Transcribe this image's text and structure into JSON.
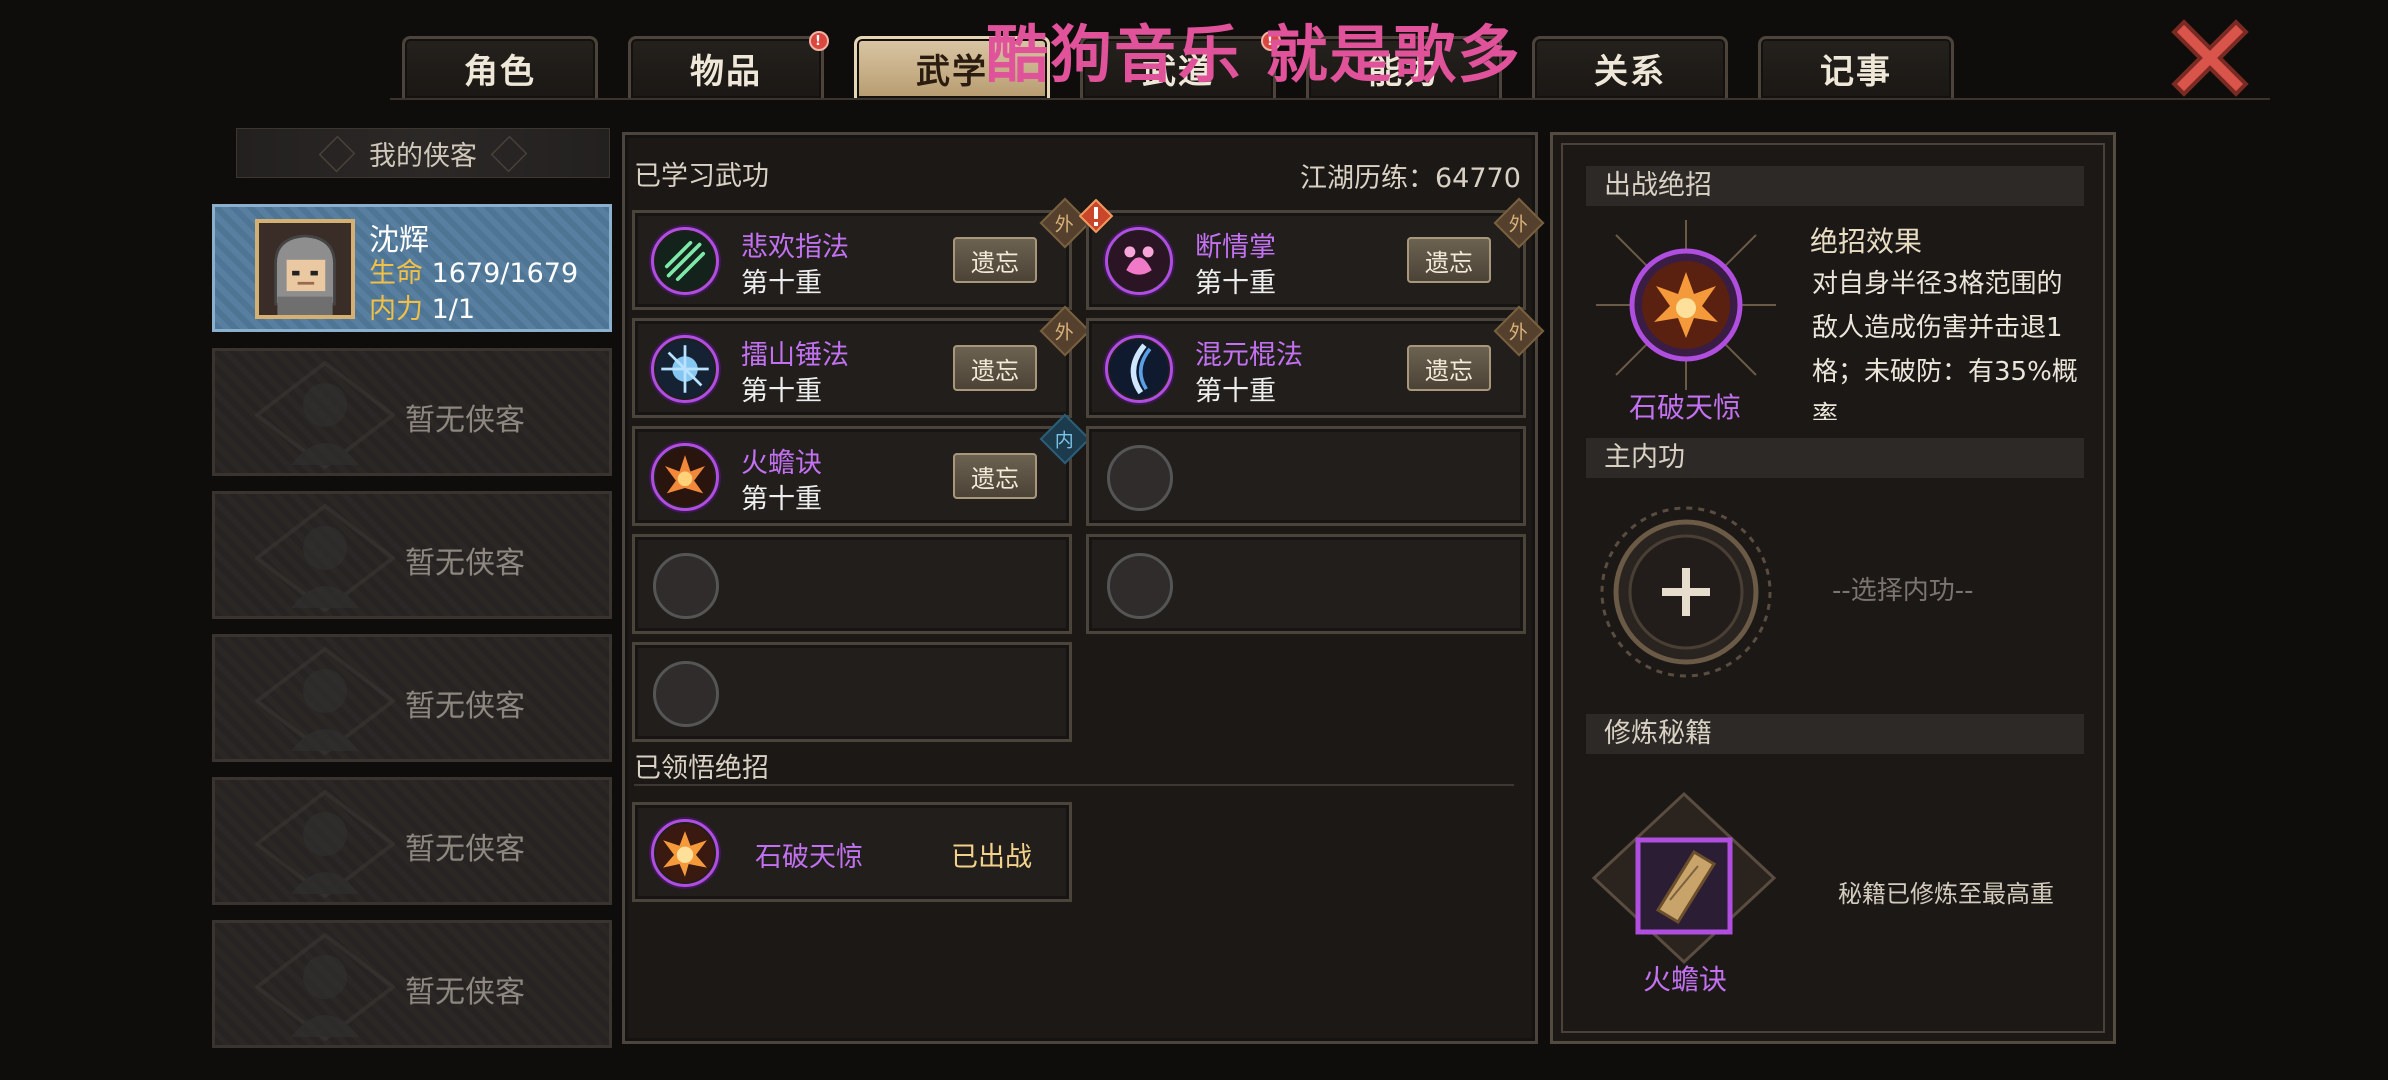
{
  "tabs": [
    {
      "label": "角色",
      "notify": false
    },
    {
      "label": "物品",
      "notify": true
    },
    {
      "label": "武学",
      "notify": false,
      "active": true
    },
    {
      "label": "武道",
      "notify": true
    },
    {
      "label": "能力",
      "notify": false
    },
    {
      "label": "关系",
      "notify": false
    },
    {
      "label": "记事",
      "notify": false
    }
  ],
  "watermark": "酷狗音乐 就是歌多",
  "left": {
    "header": "我的侠客",
    "hero": {
      "name": "沈辉",
      "hp_label": "生命",
      "hp_value": "1679/1679",
      "mp_label": "内力",
      "mp_value": "1/1"
    },
    "empty_label": "暂无侠客",
    "empty_slots": [
      "暂无侠客",
      "暂无侠客",
      "暂无侠客",
      "暂无侠客",
      "暂无侠客"
    ]
  },
  "middle": {
    "learned_title": "已学习武功",
    "xp_label": "江湖历练：64770",
    "skills": [
      {
        "name": "悲欢指法",
        "level": "第十重",
        "button": "遗忘",
        "type": "外",
        "icon": "green-claw-icon"
      },
      {
        "name": "断情掌",
        "level": "第十重",
        "button": "遗忘",
        "type": "外",
        "icon": "pink-palm-icon",
        "warning": true
      },
      {
        "name": "擂山锤法",
        "level": "第十重",
        "button": "遗忘",
        "type": "外",
        "icon": "blue-hammer-icon"
      },
      {
        "name": "混元棍法",
        "level": "第十重",
        "button": "遗忘",
        "type": "外",
        "icon": "blue-staff-icon"
      },
      {
        "name": "火蟾诀",
        "level": "第十重",
        "button": "遗忘",
        "type": "内",
        "icon": "fire-toad-icon"
      }
    ],
    "ult_title": "已领悟绝招",
    "ult": {
      "name": "石破天惊",
      "status": "已出战"
    }
  },
  "right": {
    "battle_title": "出战绝招",
    "effect_title": "绝招效果",
    "effect_text": "对自身半径3格范围的敌人造成伤害并击退1格；未破防：有35%概率",
    "ult_name": "石破天惊",
    "inner_title": "主内功",
    "inner_placeholder": "--选择内功--",
    "book_title": "修炼秘籍",
    "book_status": "秘籍已修炼至最高重",
    "book_name": "火蟾诀"
  },
  "colors": {
    "accent_purple": "#c271f0",
    "active_tab": "#d9c6a4",
    "hero_card": "#587fa0",
    "watermark": "#e0529a"
  }
}
